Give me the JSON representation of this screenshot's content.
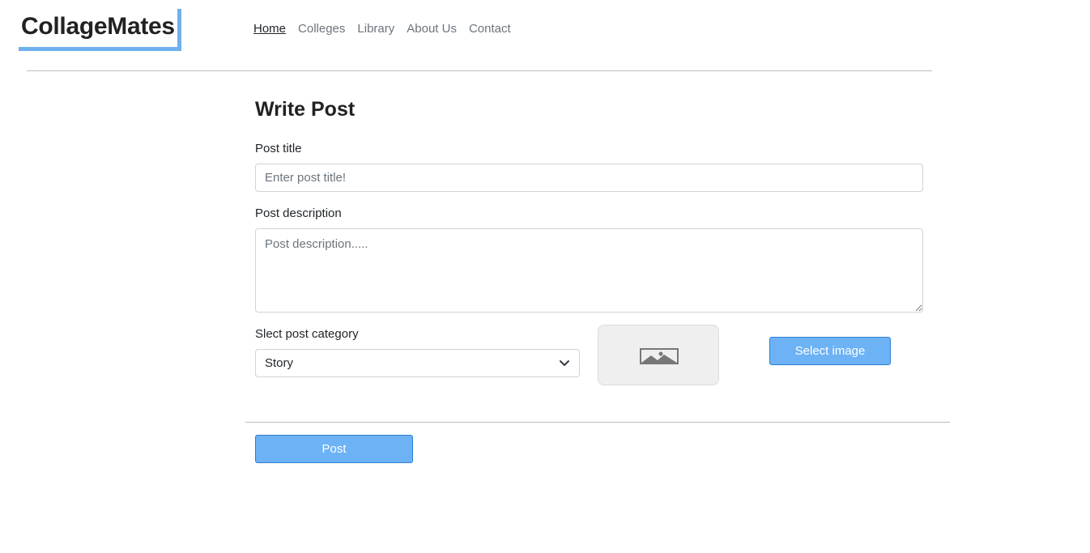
{
  "header": {
    "logo": "CollageMates",
    "nav": [
      {
        "label": "Home"
      },
      {
        "label": "Colleges"
      },
      {
        "label": "Library"
      },
      {
        "label": "About Us"
      },
      {
        "label": "Contact"
      }
    ]
  },
  "form": {
    "title": "Write Post",
    "post_title": {
      "label": "Post title",
      "placeholder": "Enter post title!"
    },
    "post_description": {
      "label": "Post description",
      "placeholder": "Post description....."
    },
    "category": {
      "label": "Slect post category",
      "selected": "Story"
    },
    "image_placeholder_icon": "image-icon",
    "select_image_button": "Select image",
    "post_button": "Post"
  },
  "colors": {
    "accent": "#6cb2f5",
    "logo_border": "#6fb0ee"
  }
}
